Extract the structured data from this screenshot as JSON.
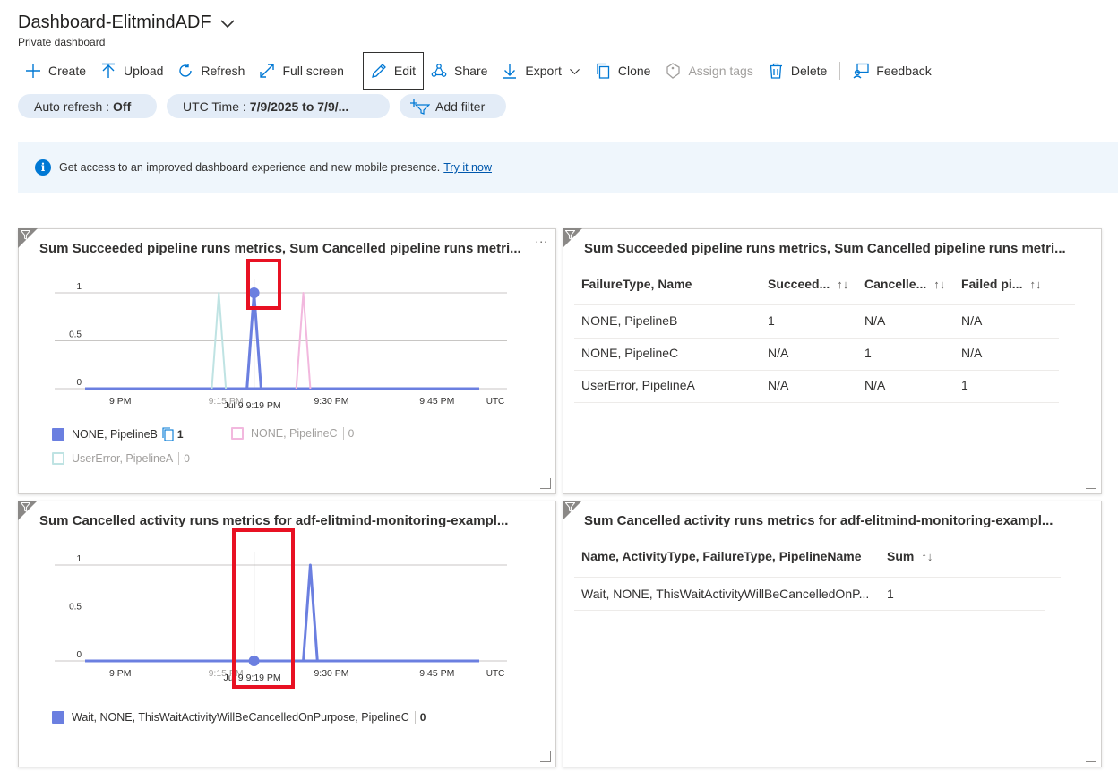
{
  "header": {
    "title": "Dashboard-ElitmindADF",
    "subtitle": "Private dashboard"
  },
  "toolbar": {
    "create": "Create",
    "upload": "Upload",
    "refresh": "Refresh",
    "fullscreen": "Full screen",
    "edit": "Edit",
    "share": "Share",
    "export": "Export",
    "clone": "Clone",
    "assign_tags": "Assign tags",
    "delete": "Delete",
    "feedback": "Feedback"
  },
  "filters": {
    "auto_refresh_label": "Auto refresh :",
    "auto_refresh_value": "Off",
    "time_label": "UTC Time :",
    "time_value": "7/9/2025 to 7/9/...",
    "add_filter": "Add filter"
  },
  "banner": {
    "text": "Get access to an improved dashboard experience and new mobile presence.",
    "link": "Try it now"
  },
  "tiles": {
    "t1": {
      "title": "Sum Succeeded pipeline runs metrics, Sum Cancelled pipeline runs metri...",
      "more": "...",
      "legend": [
        {
          "label": "NONE, PipelineB",
          "value": "1"
        },
        {
          "label": "NONE, PipelineC",
          "value": "0"
        },
        {
          "label": "UserError, PipelineA",
          "value": "0"
        }
      ]
    },
    "t2": {
      "title": "Sum Succeeded pipeline runs metrics, Sum Cancelled pipeline runs metri...",
      "columns": [
        "FailureType, Name",
        "Succeed...",
        "Cancelle...",
        "Failed pi..."
      ],
      "rows": [
        [
          "NONE, PipelineB",
          "1",
          "N/A",
          "N/A"
        ],
        [
          "NONE, PipelineC",
          "N/A",
          "1",
          "N/A"
        ],
        [
          "UserError, PipelineA",
          "N/A",
          "N/A",
          "1"
        ]
      ]
    },
    "t3": {
      "title": "Sum Cancelled activity runs metrics for adf-elitmind-monitoring-exampl...",
      "legend": [
        {
          "label": "Wait, NONE, ThisWaitActivityWillBeCancelledOnPurpose, PipelineC",
          "value": "0"
        }
      ]
    },
    "t4": {
      "title": "Sum Cancelled activity runs metrics for adf-elitmind-monitoring-exampl...",
      "columns": [
        "Name, ActivityType, FailureType, PipelineName",
        "Sum"
      ],
      "rows": [
        [
          "Wait, NONE, ThisWaitActivityWillBeCancelledOnP...",
          "1"
        ]
      ]
    }
  },
  "chart_data": [
    {
      "type": "line",
      "title": "Sum Succeeded pipeline runs metrics, Sum Cancelled pipeline runs metri...",
      "x_ticks": [
        "9 PM",
        "9:15 PM",
        "9:30 PM",
        "9:45 PM"
      ],
      "x_unit": "UTC",
      "y_ticks": [
        "0",
        "0.5",
        "1"
      ],
      "ylim": [
        0,
        1
      ],
      "cursor_label": "Jul 9 9:19 PM",
      "series": [
        {
          "name": "NONE, PipelineB",
          "color": "#6b7fe0",
          "points": [
            [
              "9:18 PM",
              0
            ],
            [
              "9:19 PM",
              1
            ],
            [
              "9:20 PM",
              0
            ]
          ]
        },
        {
          "name": "NONE, PipelineC",
          "color": "#f2b8de",
          "points": [
            [
              "9:25 PM",
              0
            ],
            [
              "9:26 PM",
              1
            ],
            [
              "9:27 PM",
              0
            ]
          ]
        },
        {
          "name": "UserError, PipelineA",
          "color": "#bfe3e3",
          "points": [
            [
              "9:13 PM",
              0
            ],
            [
              "9:14 PM",
              1
            ],
            [
              "9:15 PM",
              0
            ]
          ]
        }
      ]
    },
    {
      "type": "line",
      "title": "Sum Cancelled activity runs metrics for adf-elitmind-monitoring-exampl...",
      "x_ticks": [
        "9 PM",
        "9:15 PM",
        "9:30 PM",
        "9:45 PM"
      ],
      "x_unit": "UTC",
      "y_ticks": [
        "0",
        "0.5",
        "1"
      ],
      "ylim": [
        0,
        1
      ],
      "cursor_label": "Jul 9 9:19 PM",
      "series": [
        {
          "name": "Wait, NONE, ThisWaitActivityWillBeCancelledOnPurpose, PipelineC",
          "color": "#6b7fe0",
          "points": [
            [
              "9:26 PM",
              0
            ],
            [
              "9:27 PM",
              1
            ],
            [
              "9:28 PM",
              0
            ]
          ]
        }
      ]
    }
  ]
}
